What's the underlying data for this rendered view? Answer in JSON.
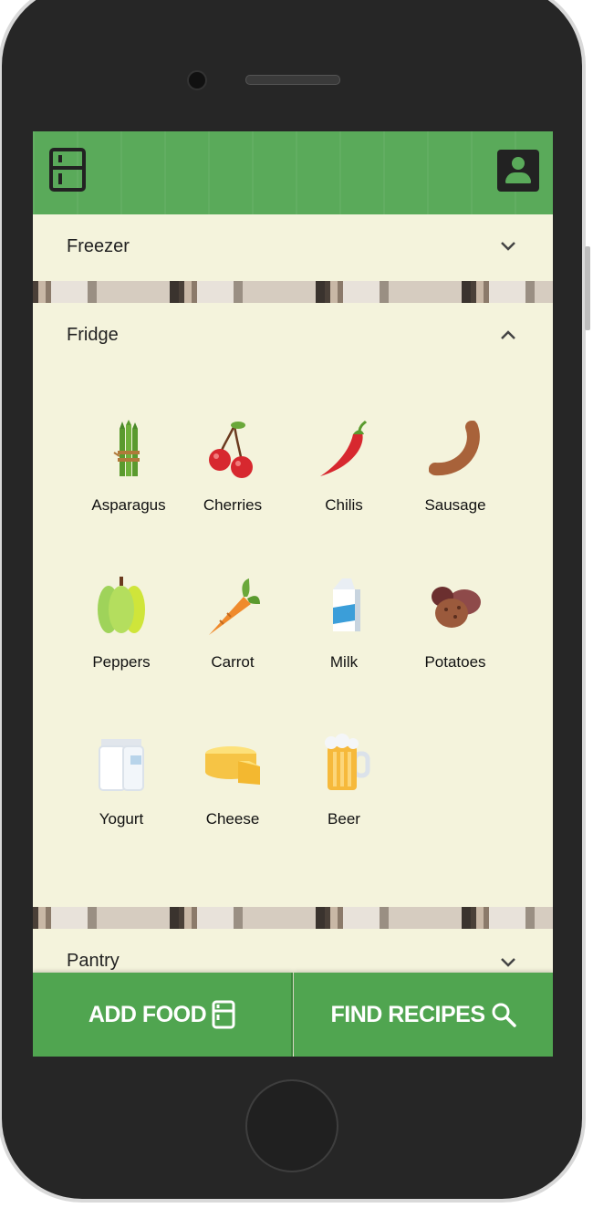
{
  "app": {
    "icons": {
      "home": "fridge-icon",
      "account": "profile-icon"
    }
  },
  "sections": [
    {
      "title": "Freezer",
      "expanded": false
    },
    {
      "title": "Fridge",
      "expanded": true
    },
    {
      "title": "Pantry",
      "expanded": false
    }
  ],
  "fridge_items": [
    {
      "label": "Asparagus",
      "icon": "asparagus-icon"
    },
    {
      "label": "Cherries",
      "icon": "cherries-icon"
    },
    {
      "label": "Chilis",
      "icon": "chili-icon"
    },
    {
      "label": "Sausage",
      "icon": "sausage-icon"
    },
    {
      "label": "Peppers",
      "icon": "peppers-icon"
    },
    {
      "label": "Carrot",
      "icon": "carrot-icon"
    },
    {
      "label": "Milk",
      "icon": "milk-icon"
    },
    {
      "label": "Potatoes",
      "icon": "potatoes-icon"
    },
    {
      "label": "Yogurt",
      "icon": "yogurt-icon"
    },
    {
      "label": "Cheese",
      "icon": "cheese-icon"
    },
    {
      "label": "Beer",
      "icon": "beer-icon"
    }
  ],
  "actions": {
    "add_food": "ADD FOOD",
    "find_recipes": "FIND RECIPES"
  },
  "colors": {
    "accent_green": "#50a550",
    "panel_cream": "#f4f3dc"
  }
}
